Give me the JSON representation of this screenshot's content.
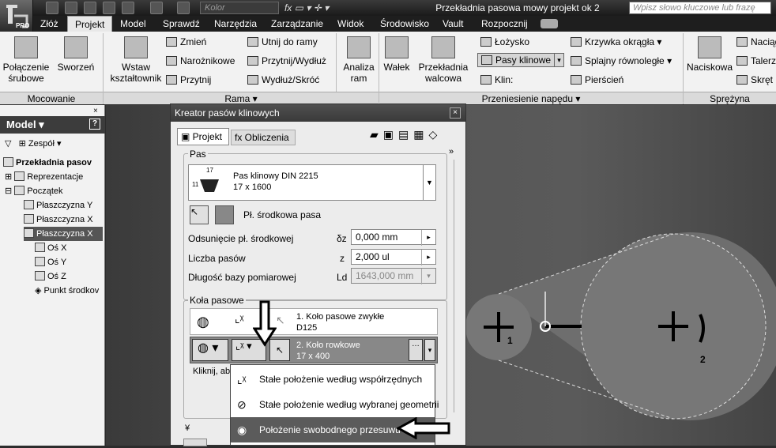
{
  "app": {
    "window_title": "Przekładnia pasowa mowy projekt ok 2",
    "search_placeholder": "Wpisz słowo kluczowe lub frazę",
    "color_field": "Kolor",
    "app_badge": "PRO"
  },
  "tabs": [
    "Złóż",
    "Projekt",
    "Model",
    "Sprawdź",
    "Narzędzia",
    "Zarządzanie",
    "Widok",
    "Środowisko",
    "Vault",
    "Rozpocznij"
  ],
  "ribbon": {
    "mocowanie": {
      "title": "Mocowanie",
      "buttons": [
        "Połączenie\nśrubowe",
        "Sworzeń"
      ]
    },
    "rama": {
      "title": "Rama",
      "large": "Wstaw\nkształtownik",
      "small": [
        "Zmień",
        "Narożnikowe",
        "Przytnij",
        "Utnij do ramy",
        "Przytnij/Wydłuż",
        "Wydłuż/Skróć"
      ],
      "analysis": "Analiza\nram"
    },
    "naped": {
      "title": "Przeniesienie napędu",
      "large": [
        "Wałek",
        "Przekładnia\nwalcowa"
      ],
      "small": [
        "Łożysko",
        "Pasy klinowe",
        "Klin:",
        "Krzywka okrągła",
        "Splajny równoległe",
        "Pierścień"
      ]
    },
    "sprezyny": {
      "title": "Sprężyna",
      "large": "Naciskowa",
      "small": [
        "Naciąg",
        "Talerz",
        "Skręt"
      ]
    }
  },
  "browser": {
    "header": "Model",
    "filter": "Zespół",
    "items": [
      "Przekładnia pasov",
      "Reprezentacje",
      "Początek",
      "Płaszczyzna Y",
      "Płaszczyzna X",
      "Płaszczyzna X",
      "Oś X",
      "Oś Y",
      "Oś Z",
      "Punkt środkov"
    ]
  },
  "dialog": {
    "title": "Kreator pasów klinowych",
    "tabs": [
      "Projekt",
      "Obliczenia"
    ],
    "pas_group": "Pas",
    "belt": {
      "name": "Pas klinowy DIN 2215",
      "size": "17 x 1600",
      "top_dim": "17",
      "side_dim": "11"
    },
    "plane_label": "Pł. środkowa pasa",
    "fields": [
      {
        "label": "Odsunięcie pł. środkowej",
        "symbol": "δz",
        "value": "0,000 mm"
      },
      {
        "label": "Liczba pasów",
        "symbol": "z",
        "value": "2,000 ul"
      },
      {
        "label": "Długość bazy pomiarowej",
        "symbol": "Ld",
        "value": "1643,000 mm"
      }
    ],
    "wheels_group": "Koła pasowe",
    "wheel1": {
      "name": "1. Koło pasowe zwykłe",
      "dim": "D125"
    },
    "wheel2": {
      "name": "2. Koło rowkowe",
      "dim": "17 x 400"
    },
    "click_hint": "Kliknij, ab",
    "dropdown": [
      "Stałe położenie według współrzędnych",
      "Stałe położenie według wybranej geometrii",
      "Położenie swobodnego przesuwu"
    ]
  },
  "viewport": {
    "label1": "1",
    "label2": "2"
  },
  "colors": {
    "ribbon": "#f2f2f2",
    "titlebar": "#1e1e1e",
    "selected": "#5b5b5b",
    "belt_fill": "#6e6e6e"
  }
}
